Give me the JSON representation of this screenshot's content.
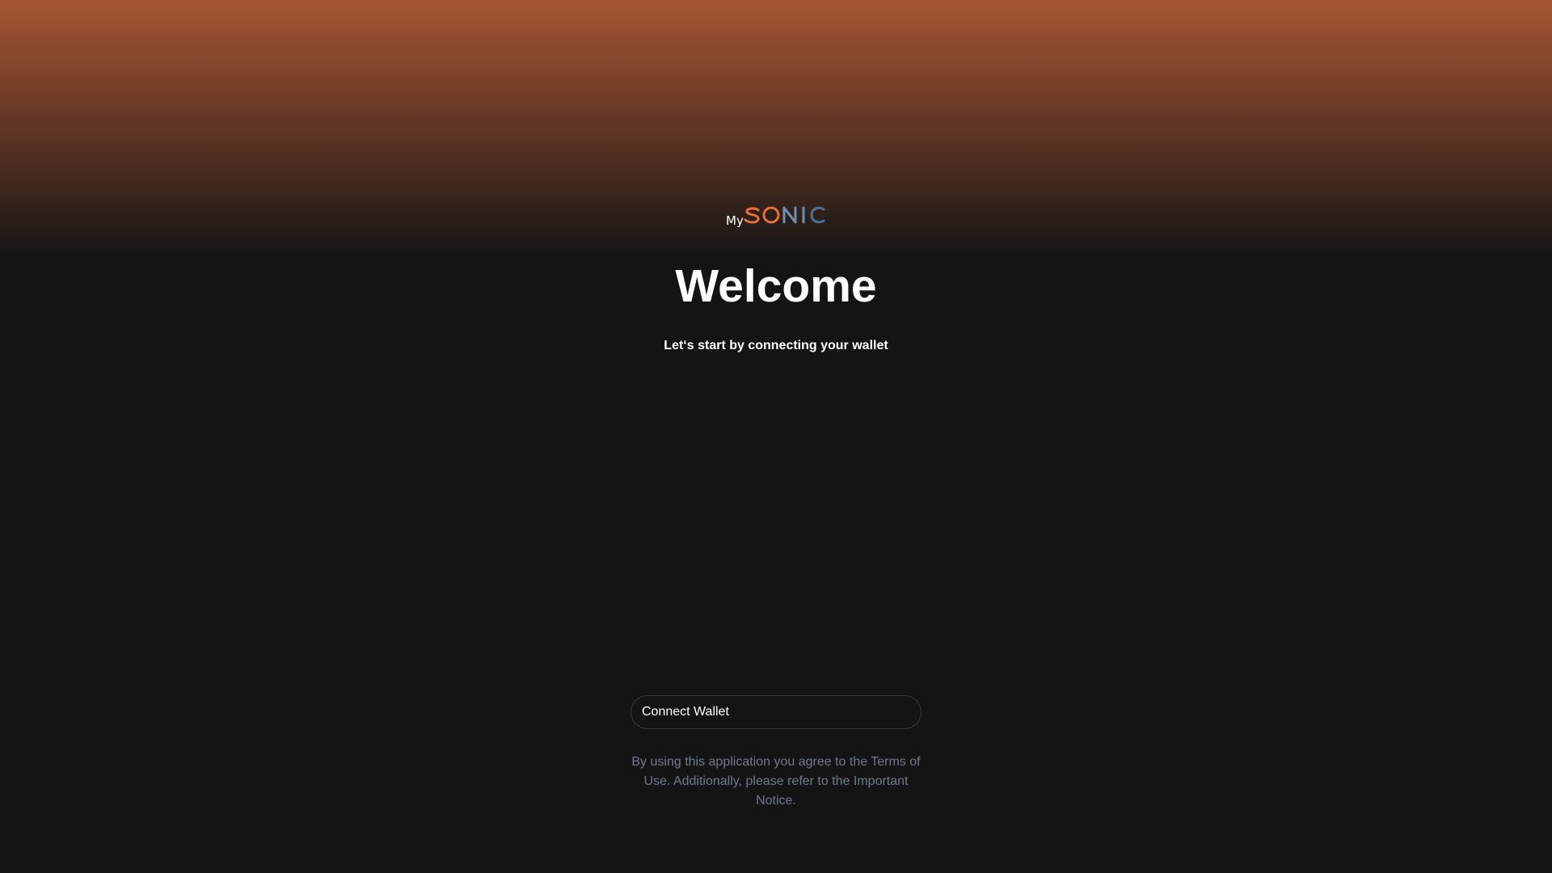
{
  "logo": {
    "prefix": "My",
    "word": "SONIC",
    "colors": {
      "prefix": "#ffffff",
      "orange": "#e8703a",
      "blue": "#5b7fa6"
    }
  },
  "header": {
    "title": "Welcome",
    "subtitle": "Let‘s start by connecting your wallet"
  },
  "actions": {
    "connect_label": "Connect Wallet"
  },
  "footer": {
    "terms_text": "By using this application you agree to the Terms of Use. Additionally, please refer to the Important Notice."
  }
}
